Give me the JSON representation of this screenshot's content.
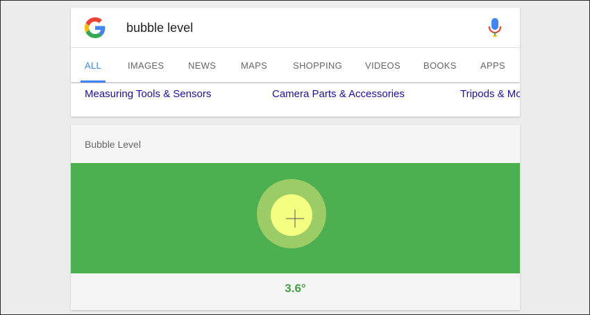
{
  "search": {
    "query": "bubble level",
    "logo_icon": "google-g-icon",
    "mic_icon": "microphone-icon"
  },
  "tabs": [
    {
      "label": "ALL",
      "active": true
    },
    {
      "label": "IMAGES",
      "active": false
    },
    {
      "label": "NEWS",
      "active": false
    },
    {
      "label": "MAPS",
      "active": false
    },
    {
      "label": "SHOPPING",
      "active": false
    },
    {
      "label": "VIDEOS",
      "active": false
    },
    {
      "label": "BOOKS",
      "active": false
    },
    {
      "label": "APPS",
      "active": false
    }
  ],
  "chips": [
    "Measuring Tools & Sensors",
    "Camera Parts & Accessories",
    "Tripods & Mo"
  ],
  "level": {
    "title": "Bubble Level",
    "angle": "3.6°"
  },
  "colors": {
    "accent": "#4285f4",
    "level_background": "#4caf50",
    "bubble": "#f4ff81",
    "angle_text": "#43a047",
    "link": "#1a0dab"
  }
}
